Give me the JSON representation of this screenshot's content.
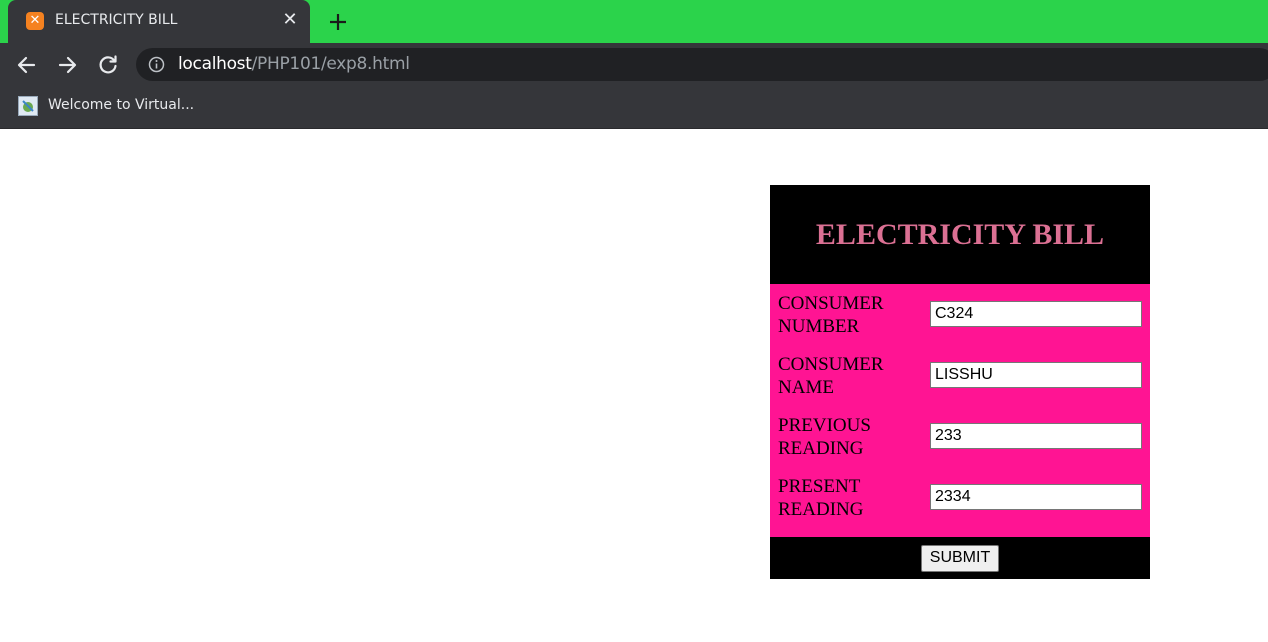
{
  "browser": {
    "tab": {
      "title": "ELECTRICITY BILL",
      "favicon_icon": "xampp-icon",
      "close_symbol": "✕"
    },
    "toolbar": {
      "url_host": "localhost",
      "url_path": "/PHP101/exp8.html",
      "info_icon": "info-circle-icon"
    },
    "bookmarks": [
      {
        "label": "Welcome to Virtual...",
        "icon": "virtual-lab-icon"
      }
    ],
    "colors": {
      "frame": "#2bd34b",
      "toolbar": "#35363a",
      "omnibox": "#202124"
    }
  },
  "form": {
    "title": "ELECTRICITY BILL",
    "fields": [
      {
        "label": "CONSUMER NUMBER",
        "value": "C324"
      },
      {
        "label": "CONSUMER NAME",
        "value": "LISSHU"
      },
      {
        "label": "PREVIOUS READING",
        "value": "233"
      },
      {
        "label": "PRESENT READING",
        "value": "2334"
      }
    ],
    "submit_label": "SUBMIT",
    "colors": {
      "header_bg": "#000000",
      "title": "#db7093",
      "body_bg": "#ff1493"
    }
  }
}
